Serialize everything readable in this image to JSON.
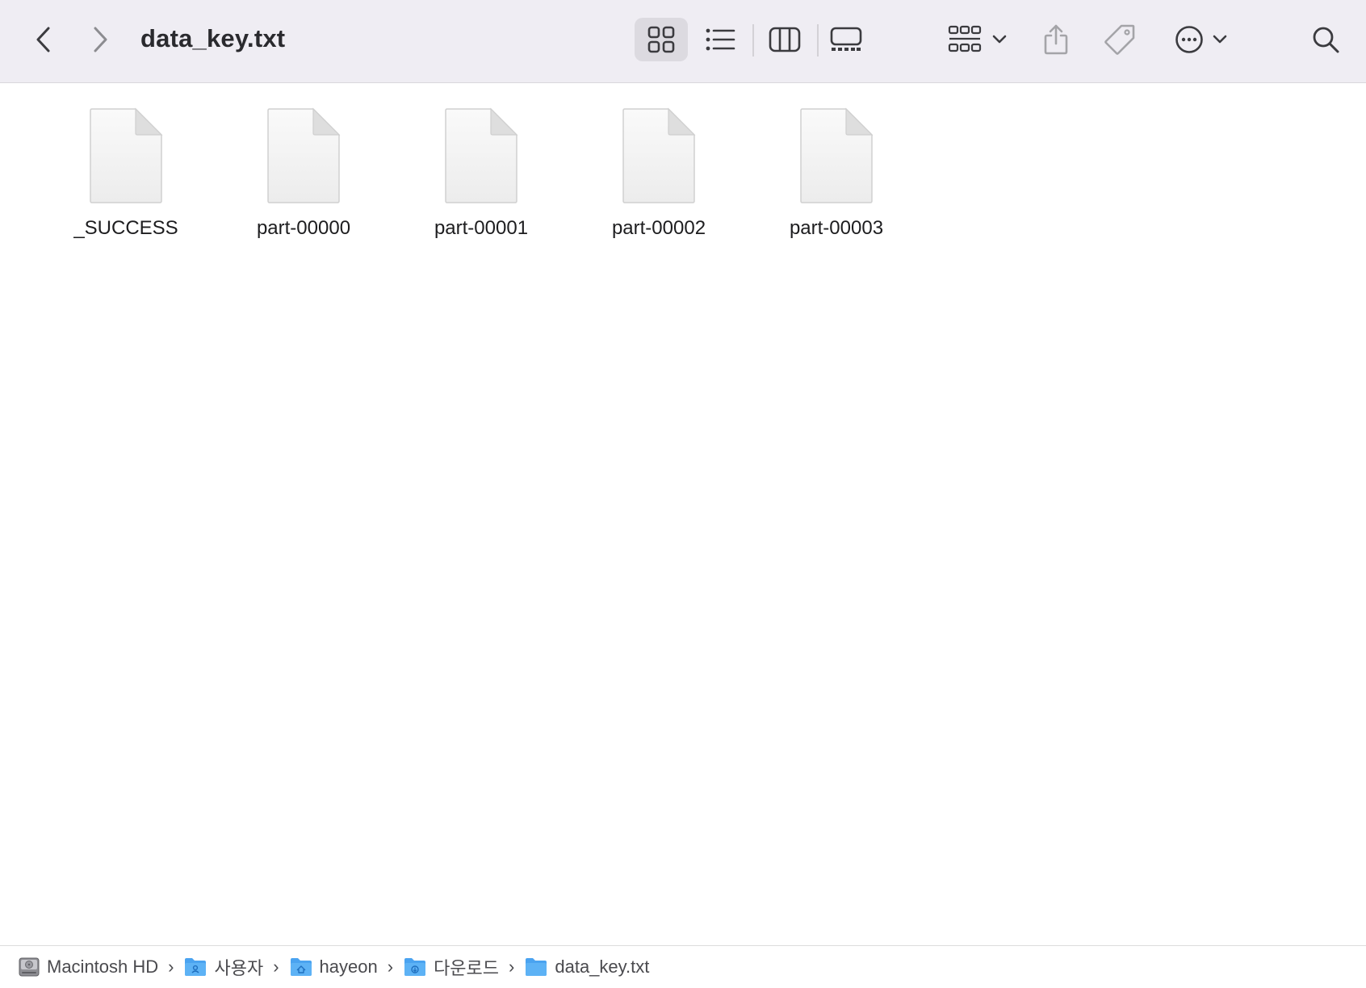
{
  "window": {
    "title": "data_key.txt"
  },
  "toolbar": {
    "back_icon": "chevron-left-icon",
    "forward_icon": "chevron-right-icon",
    "view_modes": [
      "icon-view",
      "list-view",
      "column-view",
      "gallery-view"
    ],
    "active_view": "icon-view",
    "group_icon": "group-grid-icon",
    "share_icon": "share-icon",
    "tag_icon": "tag-icon",
    "more_icon": "ellipsis-circle-icon",
    "search_icon": "magnifier-icon"
  },
  "files": [
    {
      "name": "_SUCCESS",
      "icon": "document-icon"
    },
    {
      "name": "part-00000",
      "icon": "document-icon"
    },
    {
      "name": "part-00001",
      "icon": "document-icon"
    },
    {
      "name": "part-00002",
      "icon": "document-icon"
    },
    {
      "name": "part-00003",
      "icon": "document-icon"
    }
  ],
  "pathbar": {
    "items": [
      {
        "label": "Macintosh HD",
        "icon": "hard-drive-icon"
      },
      {
        "label": "사용자",
        "icon": "users-folder-icon"
      },
      {
        "label": "hayeon",
        "icon": "home-folder-icon"
      },
      {
        "label": "다운로드",
        "icon": "downloads-folder-icon"
      },
      {
        "label": "data_key.txt",
        "icon": "folder-icon"
      }
    ],
    "separator": "›"
  },
  "colors": {
    "toolbar_bg": "#efedf3",
    "active_view_bg": "#dcdae0",
    "folder_blue": "#4aa3f0",
    "text_primary": "#1d1d1f"
  }
}
